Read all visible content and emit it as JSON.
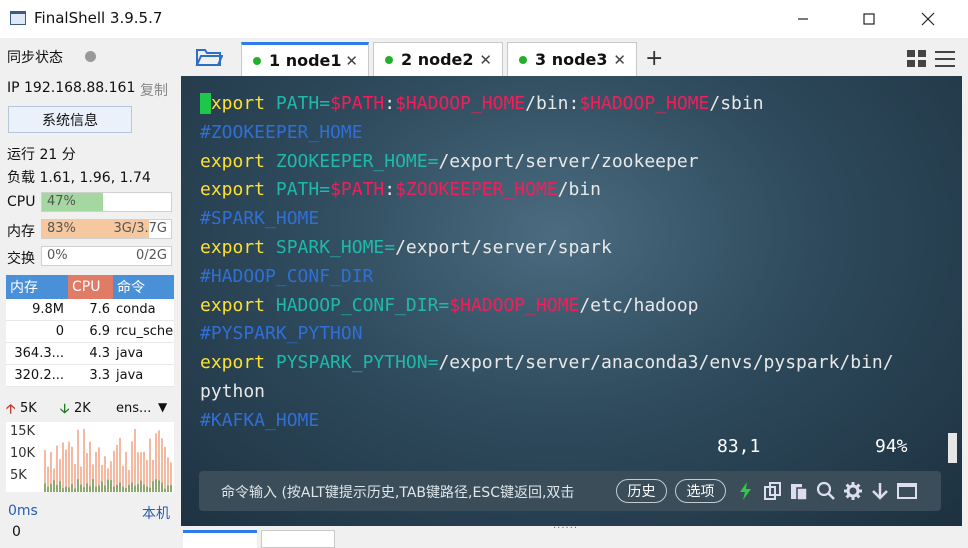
{
  "window": {
    "title": "FinalShell 3.9.5.7"
  },
  "sidebar": {
    "sync_label": "同步状态",
    "ip_label": "IP 192.168.88.161",
    "copy_label": "复制",
    "sysinfo_button": "系统信息",
    "uptime": "运行 21 分",
    "load": "负载 1.61, 1.96, 1.74",
    "cpu": {
      "label": "CPU",
      "percent_text": "47%",
      "value": 0.47,
      "color": "#a5d8a0"
    },
    "mem": {
      "label": "内存",
      "percent_text": "83%",
      "detail": "3G/3.7G",
      "value": 0.83,
      "color": "#f6c8a0"
    },
    "swap": {
      "label": "交换",
      "percent_text": "0%",
      "detail": "0/2G",
      "value": 0.0
    },
    "process_table": {
      "headers": [
        "内存",
        "CPU",
        "命令"
      ],
      "header_colors": [
        "#4a90d9",
        "#e07b66",
        "#4a90d9"
      ],
      "rows": [
        {
          "mem": "9.8M",
          "cpu": "7.6",
          "cmd": "conda"
        },
        {
          "mem": "0",
          "cpu": "6.9",
          "cmd": "rcu_sche"
        },
        {
          "mem": "364.3...",
          "cpu": "4.3",
          "cmd": "java"
        },
        {
          "mem": "320.2...",
          "cpu": "3.3",
          "cmd": "java"
        }
      ]
    },
    "net": {
      "up": "5K",
      "down": "2K",
      "iface": "ens...",
      "up_color": "#c0392b",
      "down_color": "#1f7a1f"
    },
    "net_axis": [
      "15K",
      "10K",
      "5K"
    ],
    "latency": "0ms",
    "host_label": "本机",
    "zero": "0"
  },
  "tabs": [
    {
      "label": "1 node1",
      "active": true
    },
    {
      "label": "2 node2",
      "active": false
    },
    {
      "label": "3 node3",
      "active": false
    }
  ],
  "terminal": {
    "lines": [
      [
        [
          "kw",
          "export"
        ],
        [
          "plain",
          " "
        ],
        [
          "var",
          "PATH="
        ],
        [
          "dollar",
          "$PATH"
        ],
        [
          "plain",
          ":"
        ],
        [
          "dollar",
          "$HADOOP_HOME"
        ],
        [
          "plain",
          "/bin:"
        ],
        [
          "dollar",
          "$HADOOP_HOME"
        ],
        [
          "plain",
          "/sbin"
        ]
      ],
      [
        [
          "comment",
          "#ZOOKEEPER_HOME"
        ]
      ],
      [
        [
          "kw",
          "export"
        ],
        [
          "plain",
          " "
        ],
        [
          "var",
          "ZOOKEEPER_HOME="
        ],
        [
          "plain",
          "/export/server/zookeeper"
        ]
      ],
      [
        [
          "kw",
          "export"
        ],
        [
          "plain",
          " "
        ],
        [
          "var",
          "PATH="
        ],
        [
          "dollar",
          "$PATH"
        ],
        [
          "plain",
          ":"
        ],
        [
          "dollar",
          "$ZOOKEEPER_HOME"
        ],
        [
          "plain",
          "/bin"
        ]
      ],
      [
        [
          "comment",
          "#SPARK_HOME"
        ]
      ],
      [
        [
          "kw",
          "export"
        ],
        [
          "plain",
          " "
        ],
        [
          "var",
          "SPARK_HOME="
        ],
        [
          "plain",
          "/export/server/spark"
        ]
      ],
      [
        [
          "comment",
          "#HADOOP_CONF_DIR"
        ]
      ],
      [
        [
          "kw",
          "export"
        ],
        [
          "plain",
          " "
        ],
        [
          "var",
          "HADOOP_CONF_DIR="
        ],
        [
          "dollar",
          "$HADOOP_HOME"
        ],
        [
          "plain",
          "/etc/hadoop"
        ]
      ],
      [
        [
          "comment",
          "#PYSPARK_PYTHON"
        ]
      ],
      [
        [
          "kw",
          "export"
        ],
        [
          "plain",
          " "
        ],
        [
          "var",
          "PYSPARK_PYTHON="
        ],
        [
          "plain",
          "/export/server/anaconda3/envs/pyspark/bin/"
        ]
      ],
      [
        [
          "plain",
          "python"
        ]
      ],
      [
        [
          "comment",
          "#KAFKA_HOME"
        ]
      ]
    ],
    "cursor_position": "83,1",
    "scroll_percent": "94%"
  },
  "command_bar": {
    "placeholder": "命令输入 (按ALT键提示历史,TAB键路径,ESC键返回,双击",
    "history_button": "历史",
    "options_button": "选项"
  }
}
